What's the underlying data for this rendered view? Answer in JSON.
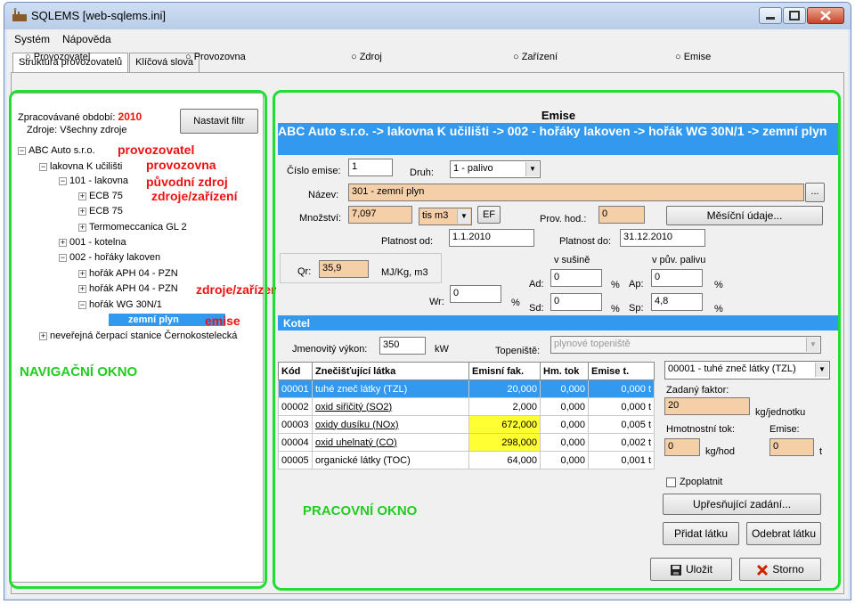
{
  "window": {
    "title": "SQLEMS [web-sqlems.ini]"
  },
  "menu": [
    "Systém",
    "Nápověda"
  ],
  "tabs": [
    "Struktura provozovatelů",
    "Klíčová slova"
  ],
  "radios": [
    "Provozovatel",
    "Provozovna",
    "Zdroj",
    "Zařízení",
    "Emise"
  ],
  "nav": {
    "period_label": "Zpracovávané období:",
    "period_value": "2010",
    "filter_label": "Zdroje: Všechny zdroje",
    "filter_button": "Nastavit filtr",
    "tree": [
      "ABC Auto s.r.o.",
      "lakovna K učilišti",
      "101 - lakovna",
      "ECB 75",
      "ECB 75",
      "Termomeccanica GL 2",
      "001 - kotelna",
      "002 - hořáky lakoven",
      "hořák APH 04 - PZN",
      "hořák APH 04 - PZN",
      "hořák WG 30N/1",
      "zemní plyn",
      "neveřejná čerpací stanice Černokostelecká"
    ],
    "annotations": {
      "provozovatel": "provozovatel",
      "provozovna": "provozovna",
      "puvodni": "původní zdroj",
      "zdroje1": "zdroje/zařízení",
      "zdroje2": "zdroje/zařízení",
      "emise": "emise"
    },
    "window_label": "NAVIGAČNÍ OKNO"
  },
  "work": {
    "header": "Emise",
    "breadcrumb": "ABC Auto s.r.o. -> lakovna K učilišti -> 002 - hořáky lakoven -> hořák  WG 30N/1 -> zemní plyn",
    "cislo_label": "Číslo emise:",
    "cislo_value": "1",
    "druh_label": "Druh:",
    "druh_value": "1 - palivo",
    "nazev_label": "Název:",
    "nazev_value": "301 - zemní plyn",
    "nazev_btn": "...",
    "mnozstvi_label": "Množství:",
    "mnozstvi_value": "7,097",
    "unit_value": "tis m3",
    "ef_btn": "EF",
    "provhod_label": "Prov. hod.:",
    "provhod_value": "0",
    "mesicni_btn": "Měsíční údaje...",
    "platnost_od_label": "Platnost od:",
    "platnost_od": "1.1.2010",
    "platnost_do_label": "Platnost do:",
    "platnost_do": "31.12.2010",
    "qr_label": "Qr:",
    "qr_value": "35,9",
    "qr_unit": "MJ/Kg, m3",
    "wr_label": "Wr:",
    "wr_value": "0",
    "pct": "%",
    "susine": "v sušině",
    "palivu": "v pův. palivu",
    "ad_label": "Ad:",
    "ad_value": "0",
    "sd_label": "Sd:",
    "sd_value": "0",
    "ap_label": "Ap:",
    "ap_value": "0",
    "sp_label": "Sp:",
    "sp_value": "4,8",
    "kotel": "Kotel",
    "vykon_label": "Jmenovitý výkon:",
    "vykon_value": "350",
    "vykon_unit": "kW",
    "topeniste_label": "Topeniště:",
    "topeniste_value": "plynové topeniště",
    "table": {
      "headers": [
        "Kód",
        "Znečišťující látka",
        "Emisní fak.",
        "Hm. tok",
        "Emise t."
      ],
      "rows": [
        [
          "00001",
          "tuhé zneč látky (TZL)",
          "20,000",
          "0,000",
          "0,000 t"
        ],
        [
          "00002",
          "oxid siřičitý  (SO2)",
          "2,000",
          "0,000",
          "0,000 t"
        ],
        [
          "00003",
          "oxidy dusíku  (NOx)",
          "672,000",
          "0,000",
          "0,005 t"
        ],
        [
          "00004",
          "oxid uhelnatý (CO)",
          "298,000",
          "0,000",
          "0,002 t"
        ],
        [
          "00005",
          "organické látky (TOC)",
          "64,000",
          "0,000",
          "0,001 t"
        ]
      ]
    },
    "latka_select": "00001 - tuhé zneč látky (TZL)",
    "faktor_label": "Zadaný faktor:",
    "faktor_value": "20",
    "faktor_unit": "kg/jednotku",
    "hmtok_label": "Hmotnostní tok:",
    "emise_label": "Emise:",
    "hmtok_value": "0",
    "hmtok_unit": "kg/hod",
    "emise_value": "0",
    "emise_unit": "t",
    "zpoplatnit": "Zpoplatnit",
    "upresnujici_btn": "Upřesňující zadání...",
    "pridat_btn": "Přidat látku",
    "odebrat_btn": "Odebrat látku",
    "window_label": "PRACOVNÍ OKNO",
    "ulozit_btn": "Uložit",
    "storno_btn": "Storno"
  },
  "colors": {
    "highlight": "#3399ee",
    "green": "#22dd33",
    "red": "#ee1111",
    "tan": "#f5cfa8",
    "yellow": "#ffff33"
  }
}
